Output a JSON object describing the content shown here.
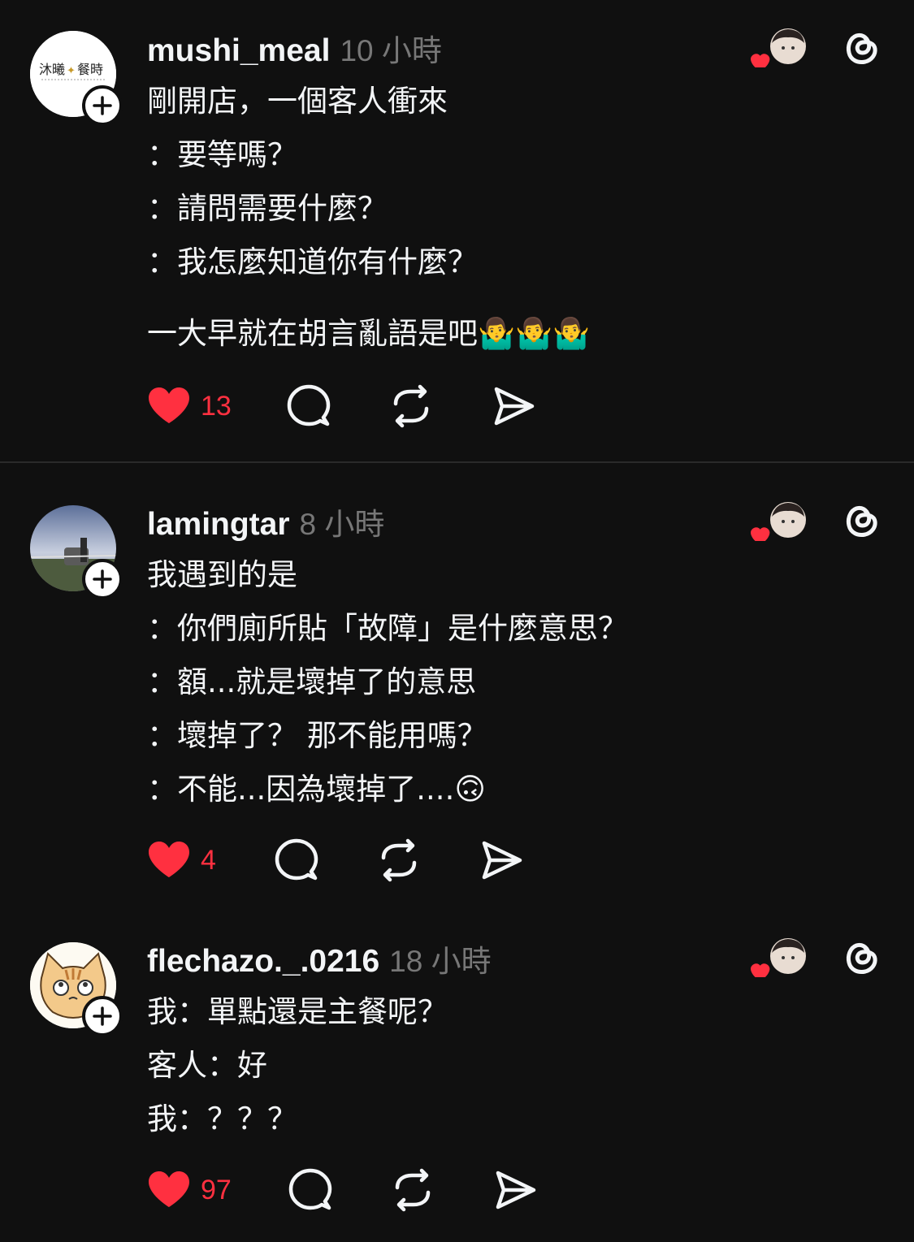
{
  "colors": {
    "background": "#101010",
    "text": "#f3f5f7",
    "muted": "#777777",
    "like": "#ff3040"
  },
  "posts": [
    {
      "username": "mushi_meal",
      "time": "10 小時",
      "avatar_logo_text": "沐曦✦餐時",
      "lines": [
        "剛開店，一個客人衝來",
        "：要等嗎？",
        "：請問需要什麼？",
        "：我怎麼知道你有什麼？",
        "",
        "一大早就在胡言亂語是吧🤷‍♂️🤷‍♂️🤷‍♂️"
      ],
      "likes": "13"
    },
    {
      "username": "lamingtar",
      "time": "8 小時",
      "lines": [
        "我遇到的是",
        "：你們廁所貼「故障」是什麼意思？",
        "：額...就是壞掉了的意思",
        "：壞掉了？ 那不能用嗎？",
        "：不能...因為壞掉了....🙃"
      ],
      "likes": "4"
    },
    {
      "username": "flechazo._.0216",
      "time": "18 小時",
      "lines": [
        "我：單點還是主餐呢？",
        "客人：好",
        "我：？？？"
      ],
      "likes": "97"
    }
  ],
  "icons": {
    "follow": "plus-icon",
    "like": "heart-icon",
    "reply": "comment-bubble-icon",
    "repost": "repost-icon",
    "share": "send-icon",
    "app": "threads-logo-icon",
    "liked_by": "liked-by-avatar"
  }
}
